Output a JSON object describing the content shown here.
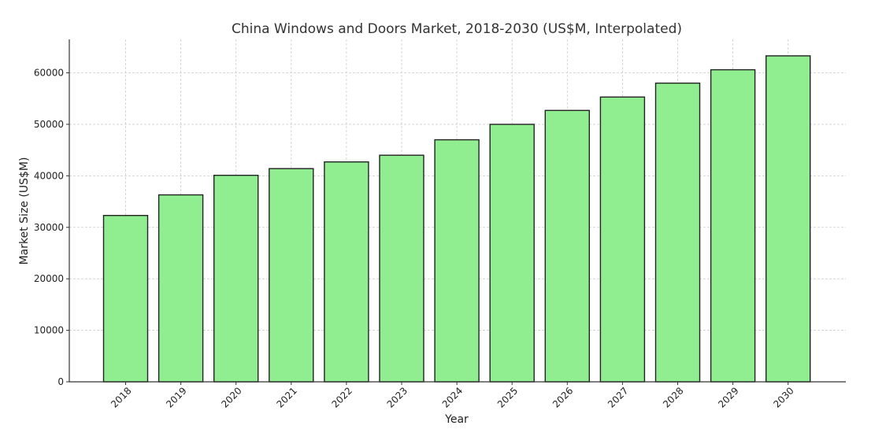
{
  "chart_data": {
    "type": "bar",
    "title": "China Windows and Doors Market, 2018-2030 (US$M, Interpolated)",
    "xlabel": "Year",
    "ylabel": "Market Size (US$M)",
    "categories": [
      "2018",
      "2019",
      "2020",
      "2021",
      "2022",
      "2023",
      "2024",
      "2025",
      "2026",
      "2027",
      "2028",
      "2029",
      "2030"
    ],
    "values": [
      32300,
      36300,
      40100,
      41400,
      42700,
      44000,
      47000,
      50000,
      52700,
      55300,
      58000,
      60600,
      63300
    ],
    "ylim": [
      0,
      66500
    ],
    "yticks": [
      0,
      10000,
      20000,
      30000,
      40000,
      50000,
      60000
    ],
    "ytick_labels": [
      "0",
      "10000",
      "20000",
      "30000",
      "40000",
      "50000",
      "60000"
    ],
    "grid": true,
    "legend": "none",
    "bar_color": "#90ee90",
    "edge_color": "#222222"
  }
}
